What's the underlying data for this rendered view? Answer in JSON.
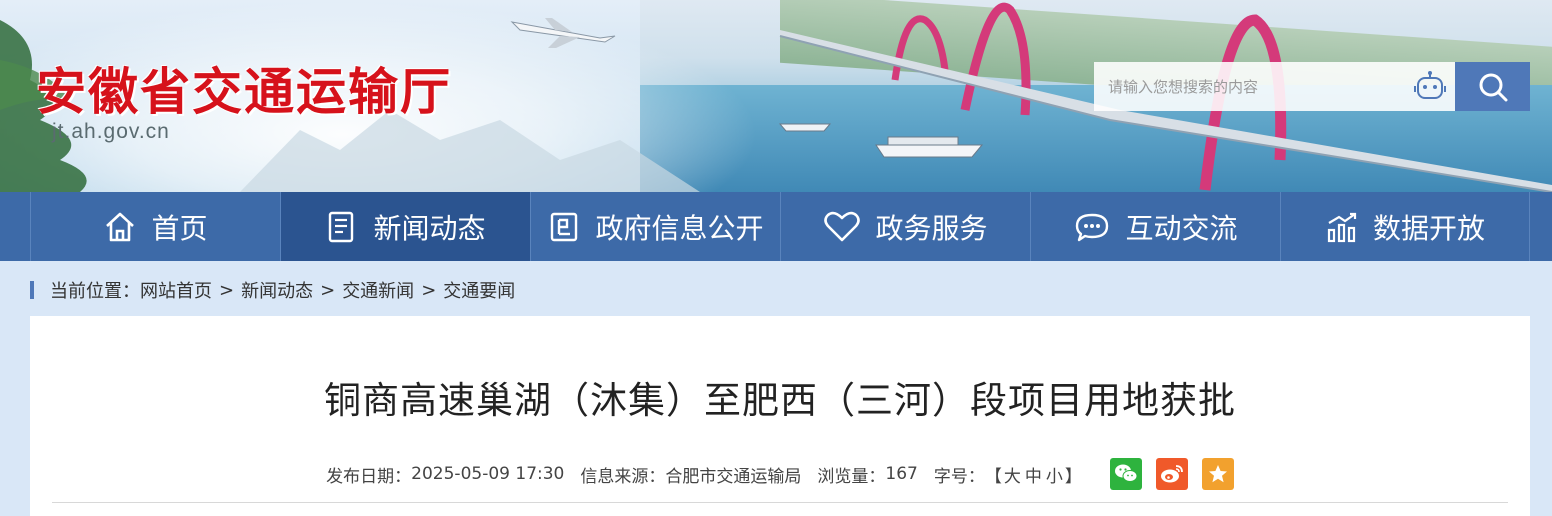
{
  "header": {
    "site_title": "安徽省交通运输厅",
    "domain": "jt.ah.gov.cn",
    "search_placeholder": "请输入您想搜索的内容"
  },
  "nav": {
    "items": [
      {
        "label": "首页",
        "icon": "home-icon"
      },
      {
        "label": "新闻动态",
        "icon": "news-icon"
      },
      {
        "label": "政府信息公开",
        "icon": "info-icon"
      },
      {
        "label": "政务服务",
        "icon": "heart-icon"
      },
      {
        "label": "互动交流",
        "icon": "chat-icon"
      },
      {
        "label": "数据开放",
        "icon": "chart-icon"
      }
    ],
    "active_index": 1
  },
  "breadcrumb": {
    "prefix": "当前位置：",
    "items": [
      "网站首页",
      "新闻动态",
      "交通新闻",
      "交通要闻"
    ],
    "separator": ">"
  },
  "article": {
    "title": "铜商高速巢湖（沐集）至肥西（三河）段项目用地获批",
    "publish_label": "发布日期：",
    "publish_date": "2025-05-09 17:30",
    "source_label": "信息来源：",
    "source": "合肥市交通运输局",
    "views_label": "浏览量：",
    "views": "167",
    "fontsize_label": "字号：",
    "fontsize_open": "【",
    "fontsize_large": "大",
    "fontsize_medium": "中",
    "fontsize_small": "小",
    "fontsize_close": "】"
  },
  "share": [
    "wechat-icon",
    "weibo-icon",
    "favorite-icon"
  ],
  "colors": {
    "nav_bg": "#3d6aa8",
    "nav_active": "#2b5490",
    "title_red": "#d6121b",
    "search_button": "#4f78b8"
  }
}
